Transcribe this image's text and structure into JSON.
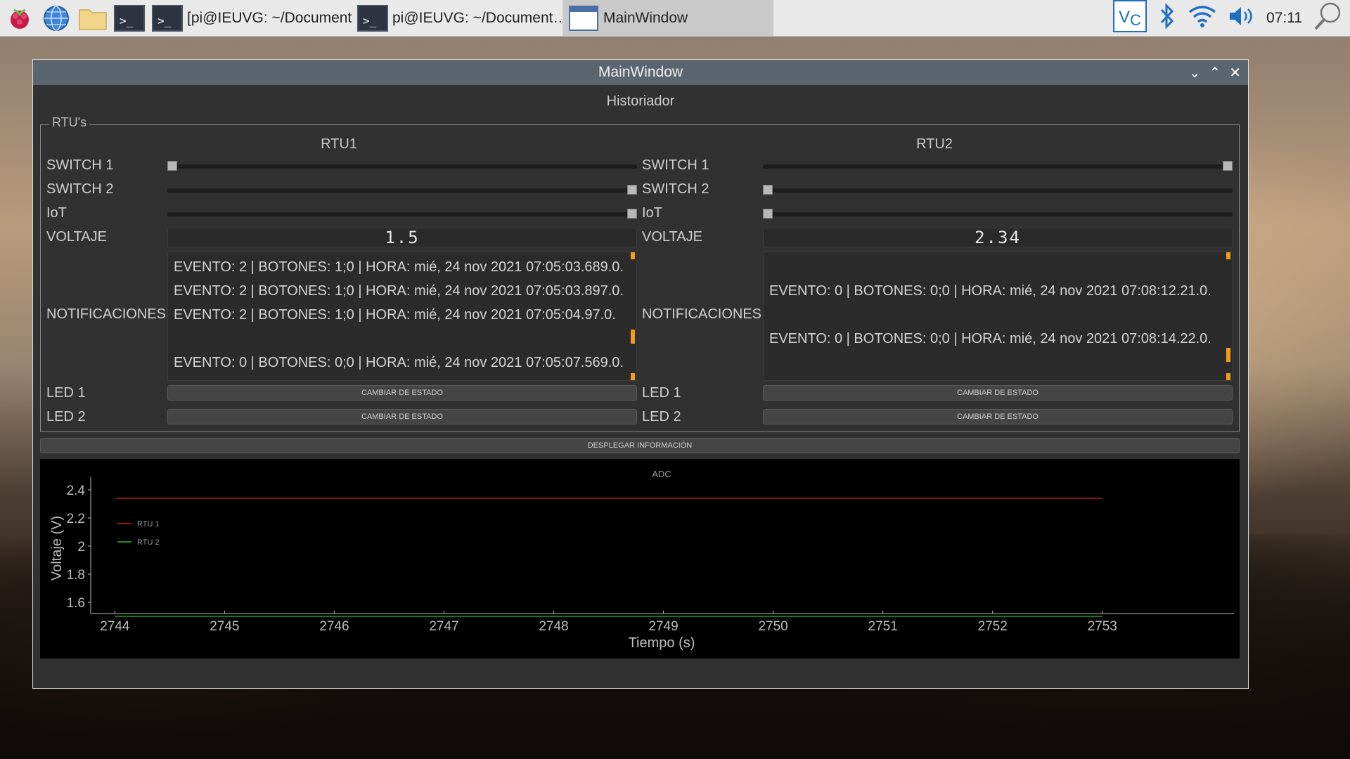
{
  "taskbar": {
    "tasks": [
      {
        "label": "[pi@IEUVG: ~/Document…",
        "active": false
      },
      {
        "label": "pi@IEUVG: ~/Document…",
        "active": false
      },
      {
        "label": "MainWindow",
        "active": true
      }
    ],
    "tray_icons": [
      "vnc-icon",
      "bluetooth-icon",
      "wifi-icon",
      "volume-icon"
    ],
    "clock": "07:11"
  },
  "window": {
    "title": "MainWindow",
    "heading": "Historiador",
    "group_title": "RTU's"
  },
  "labels": {
    "switch1": "SWITCH 1",
    "switch2": "SWITCH 2",
    "iot": "IoT",
    "voltaje": "VOLTAJE",
    "notificaciones": "NOTIFICACIONES",
    "led1": "LED 1",
    "led2": "LED 2",
    "button": "CAMBIAR DE ESTADO",
    "deploy_button": "DESPLEGAR INFORMACIÓN"
  },
  "rtu1": {
    "name": "RTU1",
    "switch1": 0,
    "switch2": 1,
    "iot": 1,
    "voltage": "1.5",
    "notifications": [
      "EVENTO: 2 | BOTONES: 1;0 | HORA: mié, 24 nov 2021 07:05:03.689.0.",
      "EVENTO: 2 | BOTONES: 1;0 | HORA: mié, 24 nov 2021 07:05:03.897.0.",
      "EVENTO: 2 | BOTONES: 1;0 | HORA: mié, 24 nov 2021 07:05:04.97.0.",
      "",
      "EVENTO: 0 | BOTONES: 0;0 | HORA: mié, 24 nov 2021 07:05:07.569.0."
    ]
  },
  "rtu2": {
    "name": "RTU2",
    "switch1": 1,
    "switch2": 0,
    "iot": 0,
    "voltage": "2.34",
    "notifications": [
      "",
      "EVENTO: 0 | BOTONES: 0;0 | HORA: mié, 24 nov 2021 07:08:12.21.0.",
      "",
      "EVENTO: 0 | BOTONES: 0;0 | HORA: mié, 24 nov 2021 07:08:14.22.0."
    ]
  },
  "chart_data": {
    "type": "line",
    "title": "ADC",
    "xlabel": "Tiempo (s)",
    "ylabel": "Voltaje (V)",
    "xlim": [
      2743.78,
      2754.2
    ],
    "ylim": [
      1.52,
      2.45
    ],
    "xticks": [
      2744,
      2745,
      2746,
      2747,
      2748,
      2749,
      2750,
      2751,
      2752,
      2753
    ],
    "yticks": [
      1.6,
      1.8,
      2,
      2.2,
      2.4
    ],
    "legend_position": "top-left",
    "series": [
      {
        "name": "RTU 1",
        "color": "#d42020",
        "x": [
          2744,
          2753
        ],
        "y": [
          2.34,
          2.34
        ]
      },
      {
        "name": "RTU 2",
        "color": "#20c020",
        "x": [
          2744,
          2753
        ],
        "y": [
          1.5,
          1.5
        ]
      }
    ]
  }
}
